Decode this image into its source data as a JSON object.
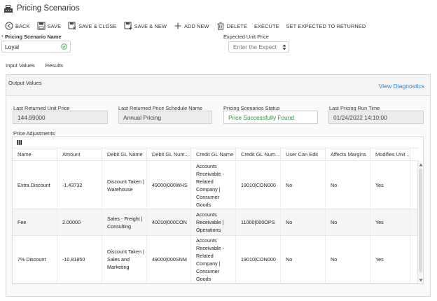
{
  "page": {
    "title": "Pricing Scenarios"
  },
  "toolbar": {
    "back": "BACK",
    "save": "SAVE",
    "save_close": "SAVE & CLOSE",
    "save_new": "SAVE & NEW",
    "add_new": "ADD NEW",
    "delete": "DELETE",
    "execute": "EXECUTE",
    "set_expected": "SET EXPECTED TO RETURNED"
  },
  "form": {
    "scenario_name_label": "Pricing Scenario Name",
    "scenario_name_required": "*",
    "scenario_name_value": "Loyal",
    "expected_price_label": "Expected Unit Price",
    "expected_price_placeholder": "Enter the Expect"
  },
  "tabs": [
    {
      "label": "Input Values"
    },
    {
      "label": "Results"
    }
  ],
  "output": {
    "title": "Output Values",
    "diagnostics_link": "View Diagnostics",
    "fields": [
      {
        "label": "Last Returned Unit Price",
        "value": "144.99000"
      },
      {
        "label": "Last Returned Price Schedule Name",
        "value": "Annual Pricing"
      },
      {
        "label": "Pricing Scenarios Status",
        "value": "Price Successfully Found"
      },
      {
        "label": "Last Pricing Run Time",
        "value": "01/24/2022 14:10:00"
      }
    ]
  },
  "adjustments": {
    "title": "Price Adjustments",
    "columns": [
      "Name",
      "Amount",
      "Debit GL Name",
      "Debit GL Num...",
      "Credit GL Name",
      "Credit GL Num...",
      "User Can Edit",
      "Affects Margins",
      "Modifies Unit ..."
    ],
    "rows": [
      {
        "cells": [
          "Extra Discount",
          "-1.43732",
          "Discount Taken | Warehouse",
          "49000|000WHS",
          "Accounts Receivable - Related Company | Consumer Goods",
          "19010|CON000",
          "No",
          "No",
          "Yes"
        ]
      },
      {
        "cells": [
          "Fee",
          "2.00000",
          "Sales - Freight | Consulting",
          "40010|000CON",
          "Accounts Receivable | Operations",
          "11000|000OPS",
          "No",
          "No",
          "Yes"
        ]
      },
      {
        "cells": [
          "7% Discount",
          "-10.81850",
          "Discount Taken | Sales and Marketing",
          "49000|000SNM",
          "Accounts Receivable - Related Company | Consumer Goods",
          "19010|CON000",
          "No",
          "No",
          "Yes"
        ]
      }
    ]
  },
  "colors": {
    "link": "#2d86c9",
    "status_ok": "#2e8b3a",
    "required": "#cc0000"
  },
  "icons": {
    "title": "cash-register-icon",
    "back": "back-arrow-circle-icon",
    "save": "floppy-disk-icon",
    "save_close": "floppy-disk-close-icon",
    "save_new": "floppy-disk-new-icon",
    "add_new": "plus-icon",
    "delete": "trash-icon",
    "name_valid": "check-circle-icon",
    "columns": "columns-icon"
  }
}
